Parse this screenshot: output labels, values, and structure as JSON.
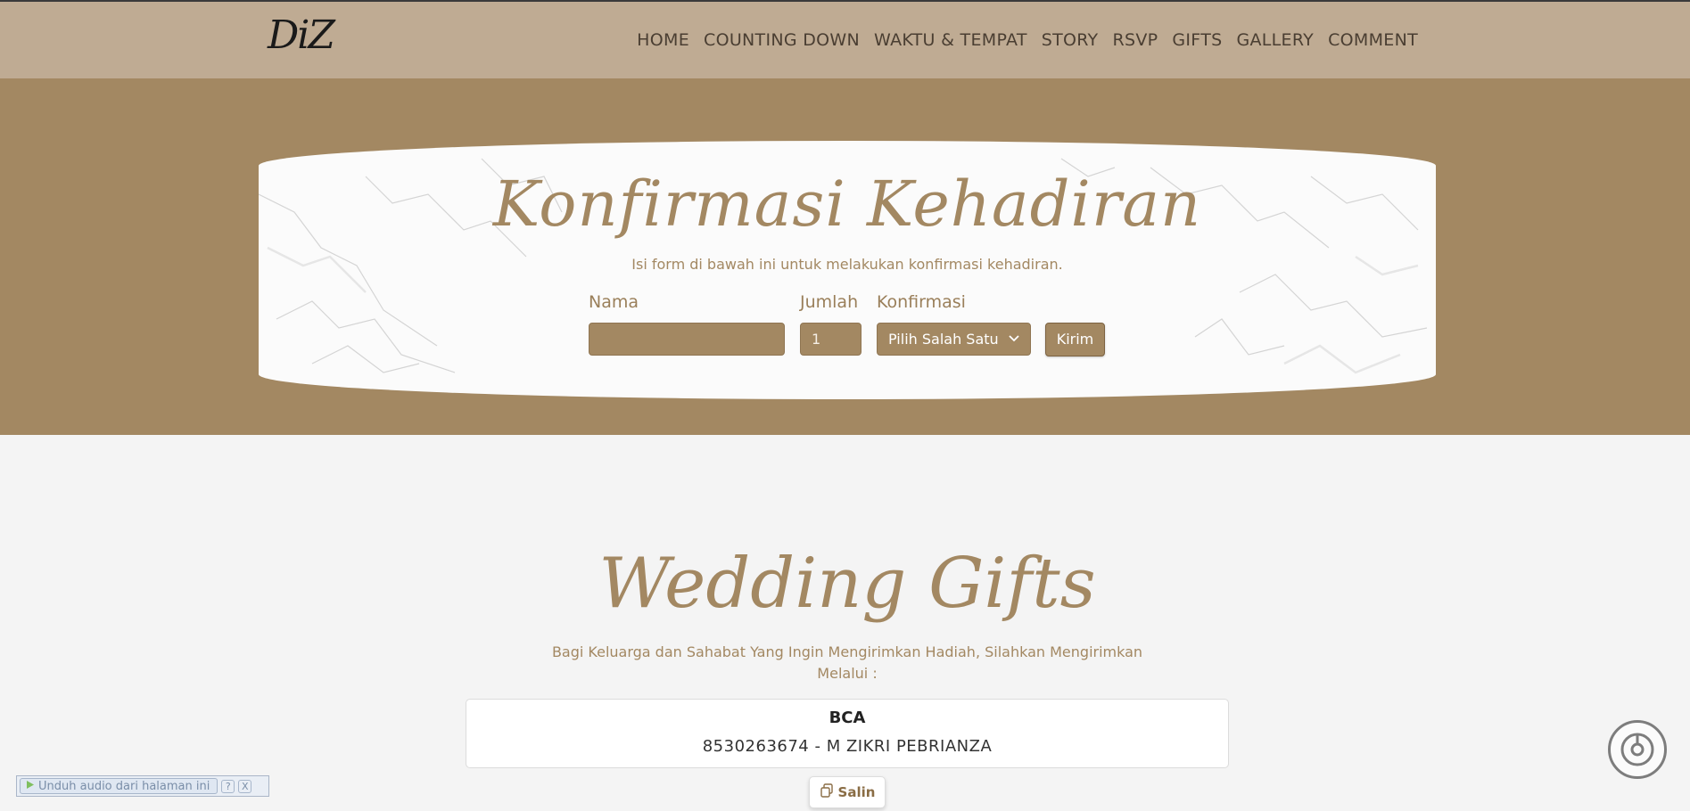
{
  "navbar": {
    "logo": "DiZ",
    "items": [
      "HOME",
      "COUNTING DOWN",
      "WAKTU & TEMPAT",
      "STORY",
      "RSVP",
      "GIFTS",
      "GALLERY",
      "COMMENT"
    ]
  },
  "rsvp": {
    "title": "Konfirmasi Kehadiran",
    "subtitle": "Isi form di bawah ini untuk melakukan konfirmasi kehadiran.",
    "nama_label": "Nama",
    "nama_value": "",
    "jumlah_label": "Jumlah",
    "jumlah_value": "1",
    "konfirmasi_label": "Konfirmasi",
    "konfirmasi_selected": "Pilih Salah Satu",
    "submit_label": "Kirim"
  },
  "gifts": {
    "title": "Wedding Gifts",
    "subtitle": "Bagi Keluarga dan Sahabat Yang Ingin Mengirimkan Hadiah, Silahkan Mengirimkan Melalui :",
    "bank_name": "BCA",
    "account_number": "8530263674",
    "account_separator": " - ",
    "account_holder": "M ZIKRI PEBRIANZA",
    "copy_label": "Salin"
  },
  "audio_bar": {
    "download_label": "Unduh audio dari halaman ini",
    "help_label": "?",
    "close_label": "X"
  },
  "colors": {
    "brand": "#a38862",
    "navbar_bg": "#bfab93",
    "page_bg": "#f4f4f4"
  },
  "icons": {
    "select": "chevron-down-icon",
    "copy": "copy-icon",
    "play": "play-icon",
    "music": "music-toggle-icon"
  }
}
